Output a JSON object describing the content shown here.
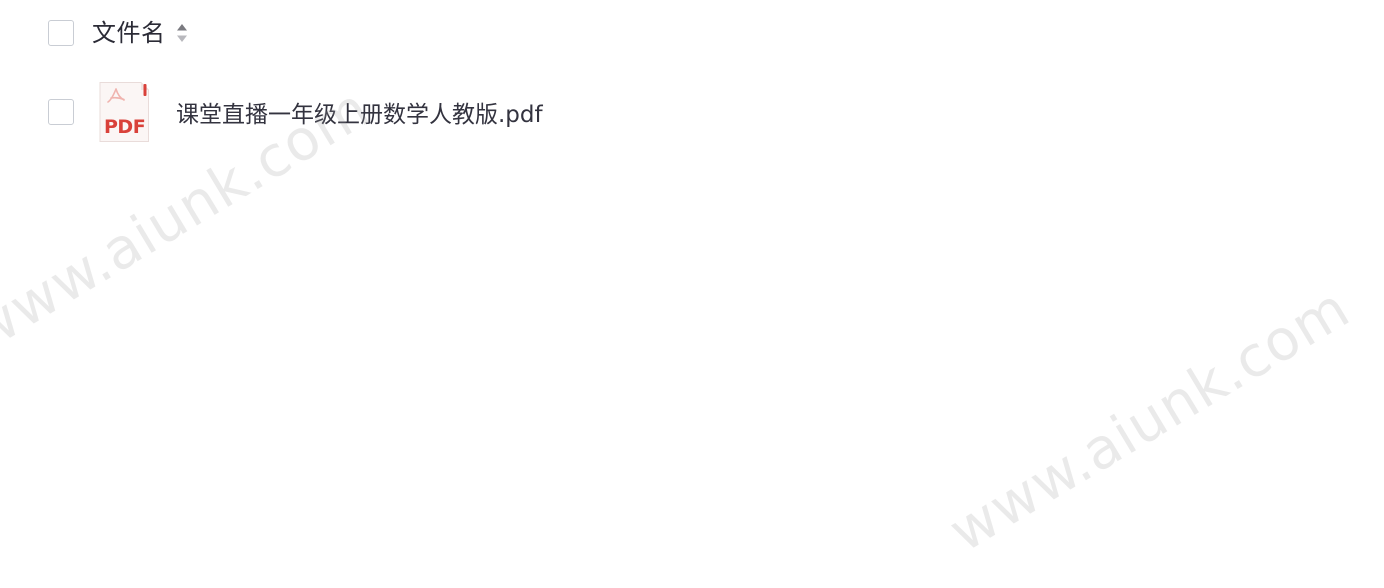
{
  "file_list": {
    "header": {
      "column_label": "文件名",
      "sort_icon": "sort-updown-icon"
    },
    "rows": [
      {
        "file_name": "课堂直播一年级上册数学人教版.pdf",
        "file_type_label": "PDF",
        "icon": "pdf-file-icon"
      }
    ]
  },
  "watermark": {
    "text": "www.aiunk.com"
  },
  "colors": {
    "pdf_red": "#d9413a",
    "checkbox_border": "#c9cdd4",
    "text": "#2e2e3a"
  }
}
